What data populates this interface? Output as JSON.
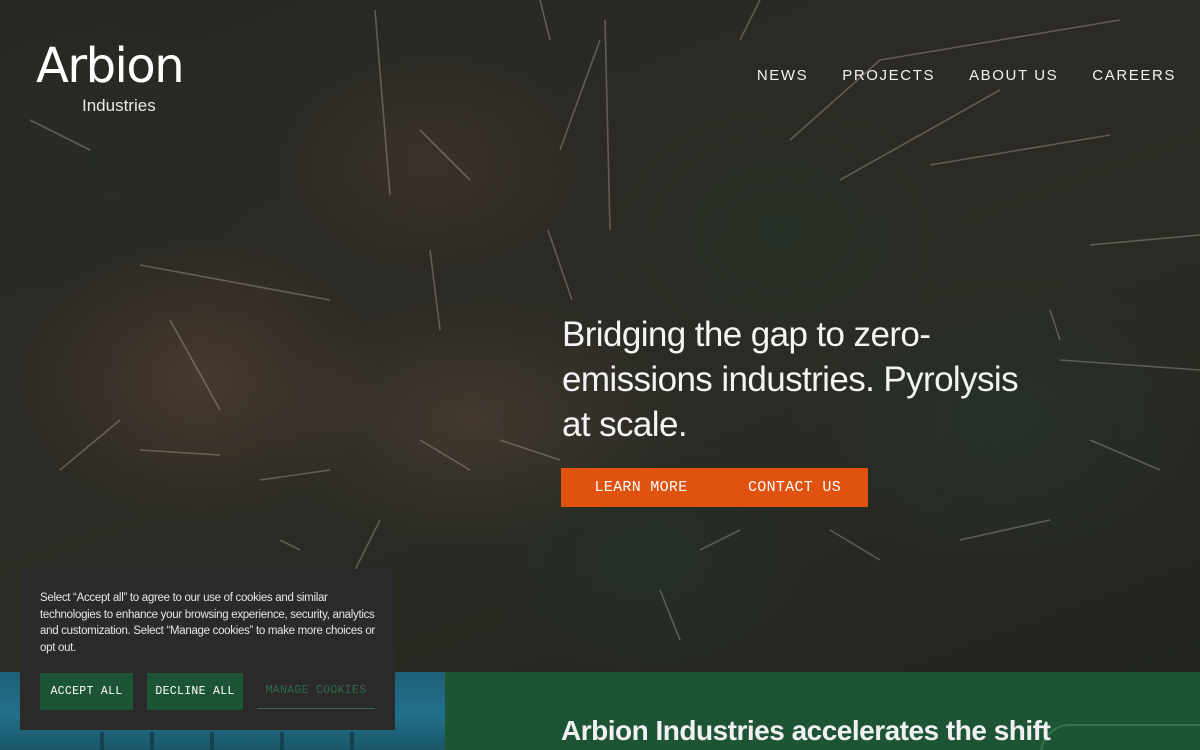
{
  "brand": {
    "name": "Arbion",
    "sub": "Industries"
  },
  "nav": {
    "items": [
      "NEWS",
      "PROJECTS",
      "ABOUT US",
      "CAREERS"
    ]
  },
  "hero": {
    "headline": "Bridging the gap to zero-emissions industries. Pyrolysis at scale.",
    "learn_more": "LEARN MORE",
    "contact_us": "CONTACT US"
  },
  "cookie": {
    "text": "Select “Accept all” to agree to our use of cookies and similar technologies to enhance your browsing experience, security, analytics and customization. Select “Manage cookies” to make more choices or opt out.",
    "accept": "ACCEPT ALL",
    "decline": "DECLINE ALL",
    "manage": "MANAGE COOKIES"
  },
  "section": {
    "title": "Arbion Industries accelerates the shift"
  },
  "colors": {
    "accent_orange": "#e0520f",
    "brand_green": "#1d5436",
    "teal": "#22708a",
    "cookie_bg": "#2a2a2a"
  }
}
